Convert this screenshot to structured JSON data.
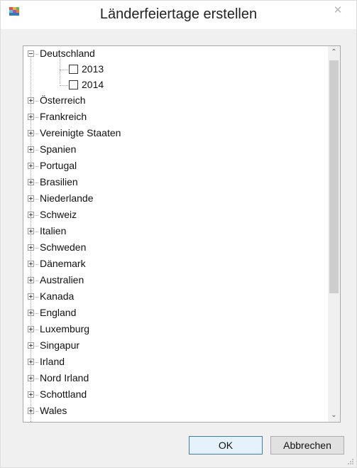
{
  "window": {
    "title": "Länderfeiertage erstellen",
    "close_symbol": "✕",
    "icon": "app-flags-icon"
  },
  "tree": {
    "root_expanded": {
      "label": "Deutschland",
      "children": [
        {
          "label": "2013",
          "checked": false
        },
        {
          "label": "2014",
          "checked": false
        }
      ]
    },
    "collapsed_items": [
      "Österreich",
      "Frankreich",
      "Vereinigte Staaten",
      "Spanien",
      "Portugal",
      "Brasilien",
      "Niederlande",
      "Schweiz",
      "Italien",
      "Schweden",
      "Dänemark",
      "Australien",
      "Kanada",
      "England",
      "Luxemburg",
      "Singapur",
      "Irland",
      "Nord Irland",
      "Schottland",
      "Wales"
    ],
    "scroll_up_symbol": "⌃",
    "scroll_down_symbol": "⌄"
  },
  "buttons": {
    "ok": "OK",
    "cancel": "Abbrechen"
  },
  "colors": {
    "accent_border": "#3c7fb1",
    "scroll_thumb": "#cdcdcd"
  }
}
